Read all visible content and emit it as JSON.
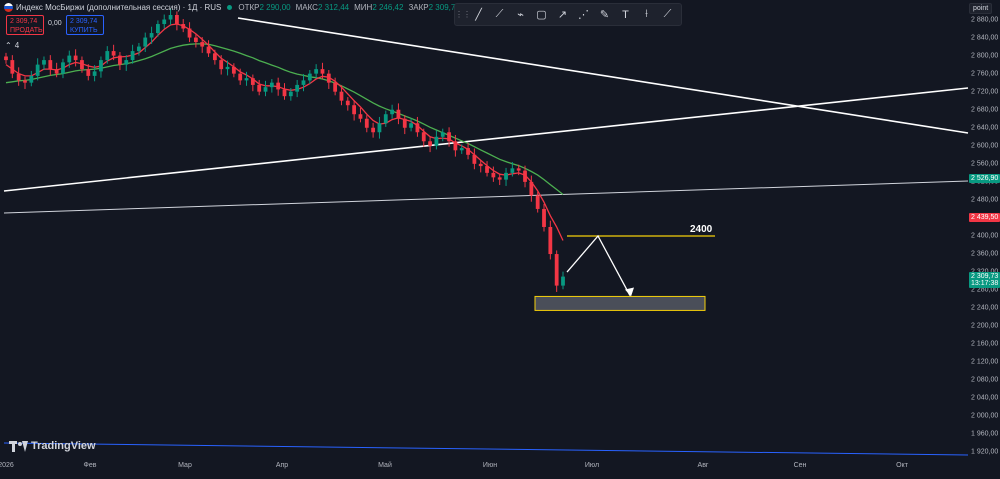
{
  "header": {
    "title": "Индекс МосБиржи (дополнительная сессия) · 1Д · RUS",
    "ohlc": [
      {
        "label": "ОТКР",
        "value": "2 290,00"
      },
      {
        "label": "МАКС",
        "value": "2 312,44"
      },
      {
        "label": "МИН",
        "value": "2 246,42"
      },
      {
        "label": "ЗАКР",
        "value": "2 309,73"
      }
    ]
  },
  "trade": {
    "sell_price": "2 309,74",
    "sell_label": "ПРОДАТЬ",
    "spread": "0,00",
    "buy_price": "2 309,74",
    "buy_label": "КУПИТЬ",
    "indicators_count": "4"
  },
  "toolbar": {
    "drag_icon": "drag-handle-icon",
    "tools": [
      {
        "name": "trend-line-icon",
        "glyph": "╱"
      },
      {
        "name": "ray-icon",
        "glyph": "⟋"
      },
      {
        "name": "path-icon",
        "glyph": "⌁"
      },
      {
        "name": "rectangle-icon",
        "glyph": "▢"
      },
      {
        "name": "arrow-icon",
        "glyph": "↗"
      },
      {
        "name": "polyline-icon",
        "glyph": "⋰"
      },
      {
        "name": "brush-icon",
        "glyph": "✎"
      },
      {
        "name": "text-icon",
        "glyph": "T"
      },
      {
        "name": "measure-icon",
        "glyph": "⟊"
      },
      {
        "name": "ruler-icon",
        "glyph": "⟋"
      }
    ]
  },
  "point_button": "point",
  "level_label": "2400",
  "logo_text": "TradingView",
  "colors": {
    "background": "#131722",
    "up": "#089981",
    "down": "#f23645",
    "ma_fast": "#f23645",
    "ma_slow": "#4caf50",
    "level": "#f5d00a",
    "blue_line": "#2962ff"
  },
  "price_tags": [
    {
      "value": "2 526,90",
      "color": "#089981"
    },
    {
      "value": "2 439,50",
      "color": "#f23645"
    },
    {
      "value": "2 309,73",
      "sub": "13:17:38",
      "color": "#089981"
    }
  ],
  "chart_data": {
    "type": "candlestick",
    "y_ticks": [
      "2 880,00",
      "2 840,00",
      "2 800,00",
      "2 760,00",
      "2 720,00",
      "2 680,00",
      "2 640,00",
      "2 600,00",
      "2 560,00",
      "2 520,00",
      "2 480,00",
      "2 440,00",
      "2 400,00",
      "2 360,00",
      "2 320,00",
      "2 280,00",
      "2 240,00",
      "2 200,00",
      "2 160,00",
      "2 120,00",
      "2 080,00",
      "2 040,00",
      "2 000,00",
      "1 960,00",
      "1 920,00"
    ],
    "y_range": [
      1920,
      2880
    ],
    "x_ticks": [
      "2026",
      "Фев",
      "Мар",
      "Апр",
      "Май",
      "Июн",
      "Июл",
      "Авг",
      "Сен",
      "Окт"
    ],
    "close_path": [
      2790,
      2760,
      2745,
      2740,
      2755,
      2780,
      2790,
      2770,
      2760,
      2785,
      2800,
      2790,
      2770,
      2755,
      2765,
      2790,
      2810,
      2800,
      2780,
      2790,
      2810,
      2820,
      2840,
      2850,
      2870,
      2880,
      2890,
      2870,
      2860,
      2840,
      2830,
      2820,
      2805,
      2790,
      2770,
      2775,
      2760,
      2745,
      2750,
      2735,
      2720,
      2730,
      2740,
      2725,
      2710,
      2720,
      2735,
      2745,
      2760,
      2770,
      2760,
      2740,
      2720,
      2700,
      2690,
      2670,
      2660,
      2640,
      2630,
      2650,
      2670,
      2680,
      2660,
      2640,
      2650,
      2630,
      2610,
      2600,
      2620,
      2630,
      2610,
      2590,
      2595,
      2580,
      2560,
      2555,
      2540,
      2530,
      2525,
      2540,
      2550,
      2545,
      2520,
      2490,
      2460,
      2420,
      2360,
      2290,
      2310
    ],
    "ma_fast": [
      2780,
      2770,
      2760,
      2755,
      2755,
      2762,
      2770,
      2770,
      2768,
      2772,
      2780,
      2785,
      2782,
      2777,
      2774,
      2777,
      2788,
      2795,
      2797,
      2798,
      2801,
      2806,
      2818,
      2830,
      2845,
      2858,
      2868,
      2870,
      2866,
      2858,
      2848,
      2836,
      2823,
      2808,
      2794,
      2785,
      2775,
      2764,
      2757,
      2748,
      2737,
      2733,
      2733,
      2731,
      2726,
      2723,
      2725,
      2730,
      2738,
      2748,
      2754,
      2752,
      2743,
      2730,
      2715,
      2700,
      2686,
      2670,
      2656,
      2648,
      2650,
      2658,
      2662,
      2658,
      2654,
      2645,
      2632,
      2620,
      2616,
      2617,
      2615,
      2606,
      2600,
      2592,
      2580,
      2568,
      2556,
      2545,
      2537,
      2535,
      2538,
      2540,
      2535,
      2520,
      2500,
      2475,
      2445,
      2420,
      2390
    ],
    "ma_slow": [
      2740,
      2742,
      2744,
      2745,
      2747,
      2750,
      2753,
      2756,
      2758,
      2760,
      2763,
      2766,
      2768,
      2769,
      2770,
      2772,
      2775,
      2778,
      2780,
      2782,
      2785,
      2789,
      2793,
      2798,
      2804,
      2810,
      2816,
      2820,
      2823,
      2825,
      2826,
      2826,
      2825,
      2822,
      2818,
      2814,
      2810,
      2805,
      2800,
      2795,
      2789,
      2784,
      2779,
      2774,
      2768,
      2763,
      2759,
      2756,
      2753,
      2751,
      2748,
      2744,
      2739,
      2733,
      2726,
      2719,
      2711,
      2703,
      2695,
      2688,
      2682,
      2677,
      2672,
      2666,
      2661,
      2655,
      2648,
      2641,
      2635,
      2629,
      2623,
      2617,
      2611,
      2605,
      2598,
      2591,
      2584,
      2577,
      2570,
      2565,
      2560,
      2556,
      2550,
      2543,
      2535,
      2525,
      2514,
      2503,
      2492
    ]
  }
}
